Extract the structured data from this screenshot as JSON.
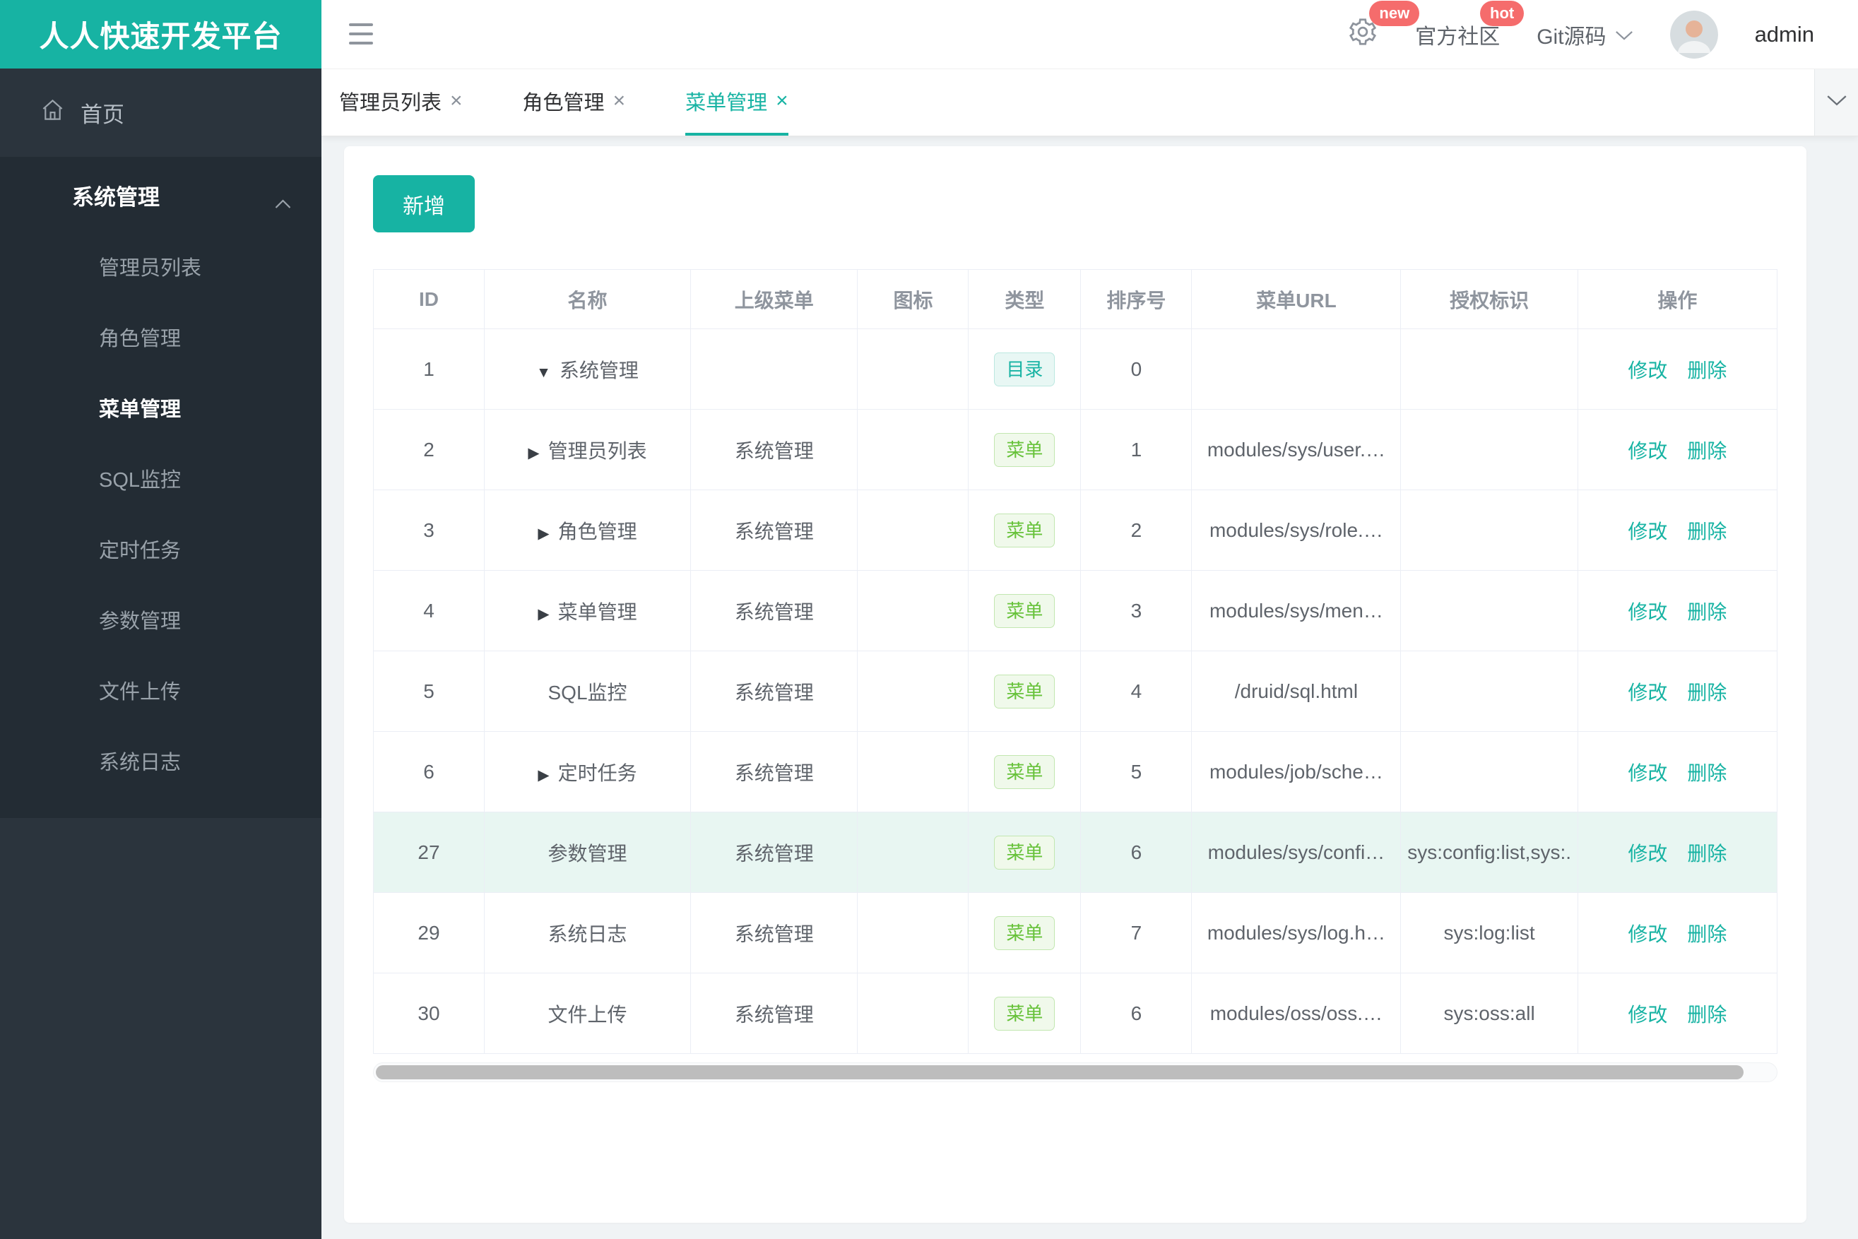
{
  "brand": {
    "title": "人人快速开发平台"
  },
  "header": {
    "gear_badge": "new",
    "community_label": "官方社区",
    "community_badge": "hot",
    "git_label": "Git源码",
    "user_name": "admin"
  },
  "sidebar": {
    "home_label": "首页",
    "section_label": "系统管理",
    "items": [
      {
        "label": "管理员列表"
      },
      {
        "label": "角色管理"
      },
      {
        "label": "菜单管理"
      },
      {
        "label": "SQL监控"
      },
      {
        "label": "定时任务"
      },
      {
        "label": "参数管理"
      },
      {
        "label": "文件上传"
      },
      {
        "label": "系统日志"
      }
    ]
  },
  "tabs": {
    "close_glyph": "×",
    "items": [
      {
        "label": "管理员列表"
      },
      {
        "label": "角色管理"
      },
      {
        "label": "菜单管理"
      }
    ]
  },
  "toolbar": {
    "add_label": "新增"
  },
  "table": {
    "headers": [
      "ID",
      "名称",
      "上级菜单",
      "图标",
      "类型",
      "排序号",
      "菜单URL",
      "授权标识",
      "操作"
    ],
    "op_edit": "修改",
    "op_delete": "删除",
    "rows": [
      {
        "id": "1",
        "arrow": "▼",
        "name": "系统管理",
        "parent": "",
        "icon": "",
        "type": "目录",
        "order": "0",
        "url": "",
        "perm": ""
      },
      {
        "id": "2",
        "arrow": "▶",
        "name": "管理员列表",
        "parent": "系统管理",
        "icon": "",
        "type": "菜单",
        "order": "1",
        "url": "modules/sys/user.…",
        "perm": ""
      },
      {
        "id": "3",
        "arrow": "▶",
        "name": "角色管理",
        "parent": "系统管理",
        "icon": "",
        "type": "菜单",
        "order": "2",
        "url": "modules/sys/role.…",
        "perm": ""
      },
      {
        "id": "4",
        "arrow": "▶",
        "name": "菜单管理",
        "parent": "系统管理",
        "icon": "",
        "type": "菜单",
        "order": "3",
        "url": "modules/sys/men…",
        "perm": ""
      },
      {
        "id": "5",
        "arrow": "",
        "name": "SQL监控",
        "parent": "系统管理",
        "icon": "",
        "type": "菜单",
        "order": "4",
        "url": "/druid/sql.html",
        "perm": ""
      },
      {
        "id": "6",
        "arrow": "▶",
        "name": "定时任务",
        "parent": "系统管理",
        "icon": "",
        "type": "菜单",
        "order": "5",
        "url": "modules/job/sche…",
        "perm": ""
      },
      {
        "id": "27",
        "arrow": "",
        "name": "参数管理",
        "parent": "系统管理",
        "icon": "",
        "type": "菜单",
        "order": "6",
        "url": "modules/sys/confi…",
        "perm": "sys:config:list,sys:."
      },
      {
        "id": "29",
        "arrow": "",
        "name": "系统日志",
        "parent": "系统管理",
        "icon": "",
        "type": "菜单",
        "order": "7",
        "url": "modules/sys/log.h…",
        "perm": "sys:log:list"
      },
      {
        "id": "30",
        "arrow": "",
        "name": "文件上传",
        "parent": "系统管理",
        "icon": "",
        "type": "菜单",
        "order": "6",
        "url": "modules/oss/oss.…",
        "perm": "sys:oss:all"
      }
    ]
  },
  "colors": {
    "brand_teal": "#17B3A3",
    "badge_red": "#F56C6C",
    "tag_dir_green": "#17B3A3",
    "tag_menu_green": "#67C23A",
    "row_highlight": "#E8F6F2"
  }
}
